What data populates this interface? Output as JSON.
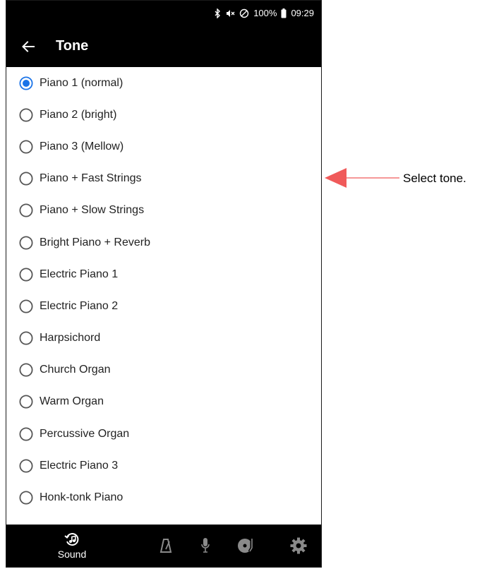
{
  "status_bar": {
    "battery": "100%",
    "time": "09:29",
    "icons": [
      "bluetooth-icon",
      "mute-icon",
      "do-not-disturb-icon",
      "battery-icon"
    ]
  },
  "app_bar": {
    "title": "Tone",
    "back_icon": "arrow-left-icon"
  },
  "tones": {
    "selected": "Piano 1 (normal)",
    "items": [
      "Piano 1 (normal)",
      "Piano 2 (bright)",
      "Piano 3 (Mellow)",
      "Piano + Fast Strings",
      "Piano + Slow Strings",
      "Bright Piano + Reverb",
      "Electric Piano 1",
      "Electric Piano 2",
      "Harpsichord",
      "Church Organ",
      "Warm Organ",
      "Percussive Organ",
      "Electric Piano 3",
      "Honk-tonk Piano"
    ]
  },
  "bottom_nav": {
    "tabs": [
      {
        "label": "Sound",
        "icon": "music-note-icon",
        "active": true
      },
      {
        "icon": "metronome-icon",
        "active": false
      },
      {
        "icon": "microphone-icon",
        "active": false
      },
      {
        "icon": "record-player-icon",
        "active": false
      },
      {
        "icon": "gear-icon",
        "active": false
      }
    ]
  },
  "callout": {
    "text": "Select tone.",
    "arrow_color": "#f05a5a"
  },
  "colors": {
    "accent": "#1a73e8",
    "radio_off": "#555555",
    "bar_bg": "#000000",
    "inactive_icon": "#8a8a8a"
  }
}
